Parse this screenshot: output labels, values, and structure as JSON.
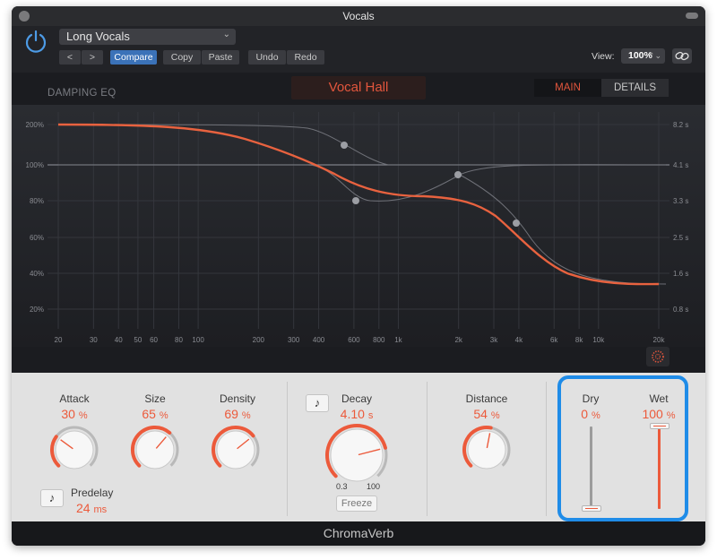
{
  "window": {
    "title": "Vocals"
  },
  "header": {
    "preset": "Long Vocals",
    "buttons": {
      "back": "<",
      "forward": ">",
      "compare": "Compare",
      "copy": "Copy",
      "paste": "Paste",
      "undo": "Undo",
      "redo": "Redo"
    },
    "view_label": "View:",
    "view_value": "100%"
  },
  "eq": {
    "section_label": "DAMPING EQ",
    "preset_name": "Vocal Hall",
    "tabs": {
      "main": "MAIN",
      "details": "DETAILS"
    },
    "left_axis": [
      "200%",
      "100%",
      "80%",
      "60%",
      "40%",
      "20%"
    ],
    "right_axis": [
      "8.2 s",
      "4.1 s",
      "3.3 s",
      "2.5 s",
      "1.6 s",
      "0.8 s"
    ],
    "freq_axis": [
      "20",
      "30",
      "40",
      "50",
      "60",
      "80",
      "100",
      "200",
      "300",
      "400",
      "600",
      "800",
      "1k",
      "2k",
      "3k",
      "4k",
      "6k",
      "8k",
      "10k",
      "20k"
    ]
  },
  "controls": {
    "attack": {
      "label": "Attack",
      "value": "30",
      "unit": "%",
      "level": 0.3
    },
    "size": {
      "label": "Size",
      "value": "65",
      "unit": "%",
      "level": 0.65
    },
    "density": {
      "label": "Density",
      "value": "69",
      "unit": "%",
      "level": 0.69
    },
    "predelay": {
      "label": "Predelay",
      "value": "24",
      "unit": "ms"
    },
    "decay": {
      "label": "Decay",
      "value": "4.10",
      "unit": "s",
      "level": 0.78,
      "min": "0.3",
      "max": "100",
      "freeze": "Freeze"
    },
    "distance": {
      "label": "Distance",
      "value": "54",
      "unit": "%",
      "level": 0.54
    },
    "dry": {
      "label": "Dry",
      "value": "0",
      "unit": "%",
      "level": 0.0
    },
    "wet": {
      "label": "Wet",
      "value": "100",
      "unit": "%",
      "level": 1.0
    }
  },
  "footer": {
    "title": "ChromaVerb"
  },
  "colors": {
    "accent": "#ec5a3b",
    "highlight": "#1f8ce8",
    "panel": "#e1e1e1"
  }
}
